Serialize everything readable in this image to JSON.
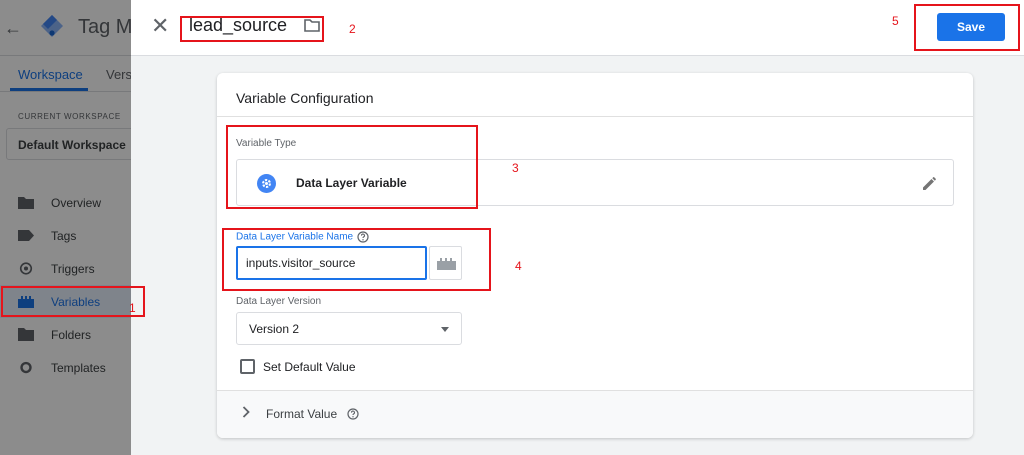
{
  "app": {
    "name": "Tag Ma",
    "tabs": [
      "Workspace",
      "Vers"
    ],
    "current_workspace_label": "CURRENT WORKSPACE",
    "current_workspace_name": "Default Workspace",
    "nav": [
      {
        "label": "Overview",
        "icon": "overview-icon",
        "active": false
      },
      {
        "label": "Tags",
        "icon": "tag-icon",
        "active": false
      },
      {
        "label": "Triggers",
        "icon": "trigger-icon",
        "active": false
      },
      {
        "label": "Variables",
        "icon": "variables-icon",
        "active": true
      },
      {
        "label": "Folders",
        "icon": "folder-icon",
        "active": false
      },
      {
        "label": "Templates",
        "icon": "templates-icon",
        "active": false
      }
    ]
  },
  "panel": {
    "title": "lead_source",
    "save_label": "Save",
    "card": {
      "title": "Variable Configuration",
      "variable_type_label": "Variable Type",
      "variable_type_name": "Data Layer Variable",
      "dl_name_label": "Data Layer Variable Name",
      "dl_name_value": "inputs.visitor_source",
      "dl_version_label": "Data Layer Version",
      "dl_version_value": "Version 2",
      "default_value_label": "Set Default Value",
      "format_value_label": "Format Value"
    }
  },
  "annotations": [
    "1",
    "2",
    "3",
    "4",
    "5"
  ],
  "colors": {
    "accent": "#1a73e8",
    "annotation": "#e5141b"
  }
}
